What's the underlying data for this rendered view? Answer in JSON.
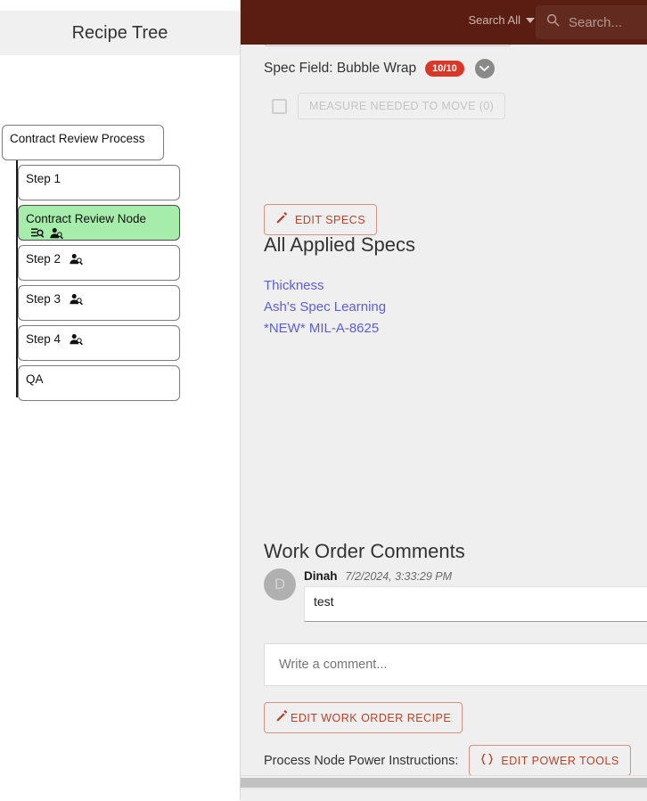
{
  "sidebar": {
    "title": "Recipe Tree",
    "tree": {
      "root": {
        "label": "Contract Review Process",
        "icons": []
      },
      "children": [
        {
          "label": "Step 1",
          "icons": []
        },
        {
          "label": "Contract Review Node",
          "icons": [
            "list-search-icon",
            "person-search-icon"
          ],
          "selected": true
        },
        {
          "label": "Step 2",
          "icons": [
            "person-search-icon"
          ]
        },
        {
          "label": "Step 3",
          "icons": [
            "person-search-icon"
          ]
        },
        {
          "label": "Step 4",
          "icons": [
            "person-search-icon"
          ]
        },
        {
          "label": "QA",
          "icons": []
        }
      ]
    }
  },
  "topbar": {
    "background_color": "#5a1d12",
    "search_scope_label": "Search All",
    "search_placeholder": "Search...",
    "search_icon": "magnifier-icon",
    "caret_icon": "chevron-down-icon"
  },
  "main": {
    "spec_field": {
      "label": "Spec Field: Bubble Wrap",
      "badge": "10/10",
      "badge_color": "#d8372a",
      "expand_icon": "chevron-down-circle-icon"
    },
    "measure": {
      "checkbox_checked": false,
      "button_label": "MEASURE NEEDED TO MOVE (0)"
    },
    "edit_specs_label": "EDIT SPECS",
    "edit_specs_icon": "pencil-icon",
    "all_applied_specs_title": "All Applied Specs",
    "spec_links": [
      "Thickness",
      "Ash's Spec Learning",
      "*NEW* MIL-A-8625"
    ],
    "comments": {
      "title": "Work Order Comments",
      "items": [
        {
          "avatar_initial": "D",
          "author": "Dinah",
          "timestamp": "7/2/2024, 3:33:29 PM",
          "body": "test"
        }
      ],
      "input_placeholder": "Write a comment..."
    },
    "edit_work_order_label": "EDIT WORK ORDER RECIPE",
    "edit_work_order_icon": "pencil-icon",
    "power_instructions_label": "Process Node Power Instructions:",
    "edit_power_tools_label": "EDIT POWER TOOLS",
    "edit_power_tools_icon": "braces-icon",
    "accent_color": "#b5432c"
  }
}
